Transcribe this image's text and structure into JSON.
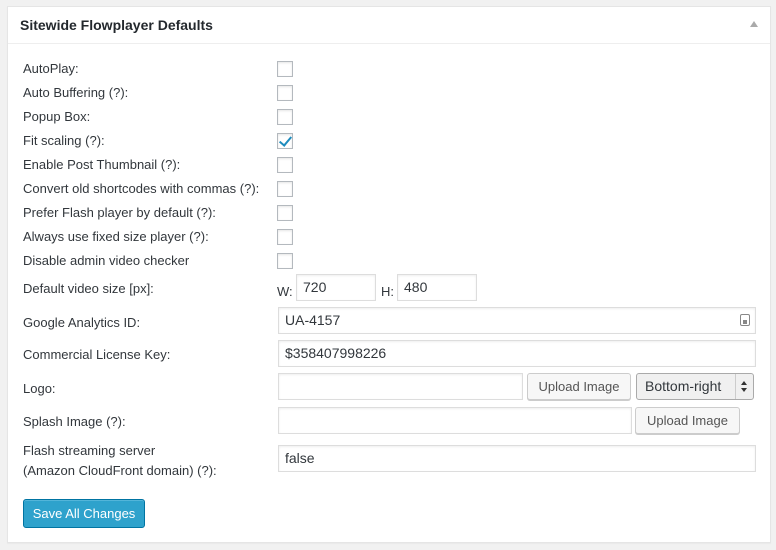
{
  "panel": {
    "title": "Sitewide Flowplayer Defaults"
  },
  "checkboxes": [
    {
      "label": "AutoPlay:",
      "checked": false
    },
    {
      "label": "Auto Buffering (?):",
      "checked": false
    },
    {
      "label": "Popup Box:",
      "checked": false
    },
    {
      "label": "Fit scaling (?):",
      "checked": true
    },
    {
      "label": "Enable Post Thumbnail (?):",
      "checked": false
    },
    {
      "label": "Convert old shortcodes with commas (?):",
      "checked": false
    },
    {
      "label": "Prefer Flash player by default (?):",
      "checked": false
    },
    {
      "label": "Always use fixed size player (?):",
      "checked": false
    },
    {
      "label": "Disable admin video checker",
      "checked": false
    }
  ],
  "video_size": {
    "label": "Default video size [px]:",
    "width_label": "W:",
    "width_value": "720",
    "height_label": "H:",
    "height_value": "480"
  },
  "analytics": {
    "label": "Google Analytics ID:",
    "value": "UA-4157"
  },
  "license": {
    "label": "Commercial License Key:",
    "value": "$358407998226"
  },
  "logo": {
    "label": "Logo:",
    "value": "",
    "upload_label": "Upload Image",
    "position_selected": "Bottom-right"
  },
  "splash": {
    "label": "Splash Image (?):",
    "value": "",
    "upload_label": "Upload Image"
  },
  "streaming": {
    "label_line1": "Flash streaming server",
    "label_line2": "(Amazon CloudFront domain) (?):",
    "value": "false"
  },
  "save_label": "Save All Changes",
  "colors": {
    "primary": "#2ea2cc",
    "check": "#1e8cbe"
  }
}
